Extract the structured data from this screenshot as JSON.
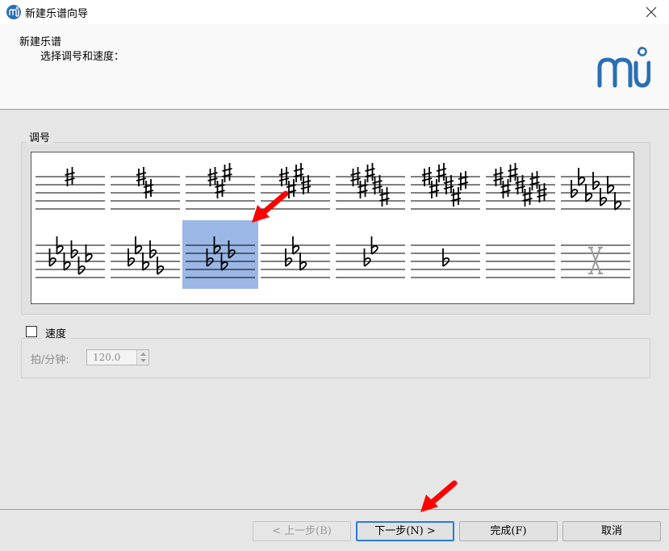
{
  "window": {
    "title": "新建乐谱向导",
    "close_icon": "close-icon",
    "app_icon": "musescore-app-icon"
  },
  "header": {
    "title": "新建乐谱",
    "subtitle": "选择调号和速度：",
    "logo": "musescore-logo"
  },
  "key_signature": {
    "group_label": "调号",
    "selected_index": 10,
    "items": [
      {
        "accidental": "sharp",
        "count": 1
      },
      {
        "accidental": "sharp",
        "count": 2
      },
      {
        "accidental": "sharp",
        "count": 3
      },
      {
        "accidental": "sharp",
        "count": 4
      },
      {
        "accidental": "sharp",
        "count": 5
      },
      {
        "accidental": "sharp",
        "count": 6
      },
      {
        "accidental": "sharp",
        "count": 7
      },
      {
        "accidental": "flat",
        "count": 7
      },
      {
        "accidental": "flat",
        "count": 6
      },
      {
        "accidental": "flat",
        "count": 5
      },
      {
        "accidental": "flat",
        "count": 4
      },
      {
        "accidental": "flat",
        "count": 3
      },
      {
        "accidental": "flat",
        "count": 2
      },
      {
        "accidental": "flat",
        "count": 1
      },
      {
        "accidental": "none",
        "count": 0
      },
      {
        "accidental": "atonal",
        "count": 0
      }
    ]
  },
  "tempo": {
    "checkbox_label": "速度",
    "checked": false,
    "field_label": "拍/分钟:",
    "value": "120.0"
  },
  "buttons": {
    "back": "< 上一步(B)",
    "next": "下一步(N) >",
    "finish": "完成(F)",
    "cancel": "取消"
  },
  "colors": {
    "selection": "#9ab7e6",
    "annotation_arrow": "#ff0000",
    "logo": "#2a6fb5"
  }
}
